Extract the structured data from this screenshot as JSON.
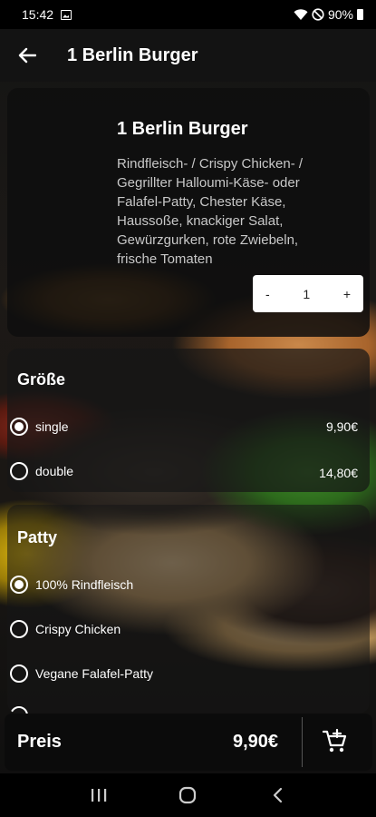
{
  "status": {
    "time": "15:42",
    "battery": "90%"
  },
  "app_bar": {
    "title": "1 Berlin Burger"
  },
  "product": {
    "title": "1 Berlin Burger",
    "description": "Rindfleisch- / Crispy Chicken- / Gegrillter Halloumi-Käse- oder Falafel-Patty, Chester Käse, Haussoße, knackiger Salat, Gewürzgurken, rote Zwiebeln, frische Tomaten",
    "quantity": {
      "minus": "-",
      "value": "1",
      "plus": "+"
    }
  },
  "size_section": {
    "title": "Größe",
    "options": [
      {
        "label": "single",
        "price": "9,90€",
        "selected": true
      },
      {
        "label": "double",
        "price": "14,80€",
        "selected": false
      }
    ]
  },
  "patty_section": {
    "title": "Patty",
    "options": [
      {
        "label": "100% Rindfleisch",
        "selected": true
      },
      {
        "label": "Crispy Chicken",
        "selected": false
      },
      {
        "label": "Vegane Falafel-Patty",
        "selected": false
      }
    ]
  },
  "footer": {
    "price_label": "Preis",
    "price_value": "9,90€"
  },
  "icons": {
    "back": "arrow-left-icon",
    "cart": "add-to-cart-icon",
    "nav_recent": "recent-apps-icon",
    "nav_home": "home-icon",
    "nav_back": "chevron-left-icon"
  }
}
